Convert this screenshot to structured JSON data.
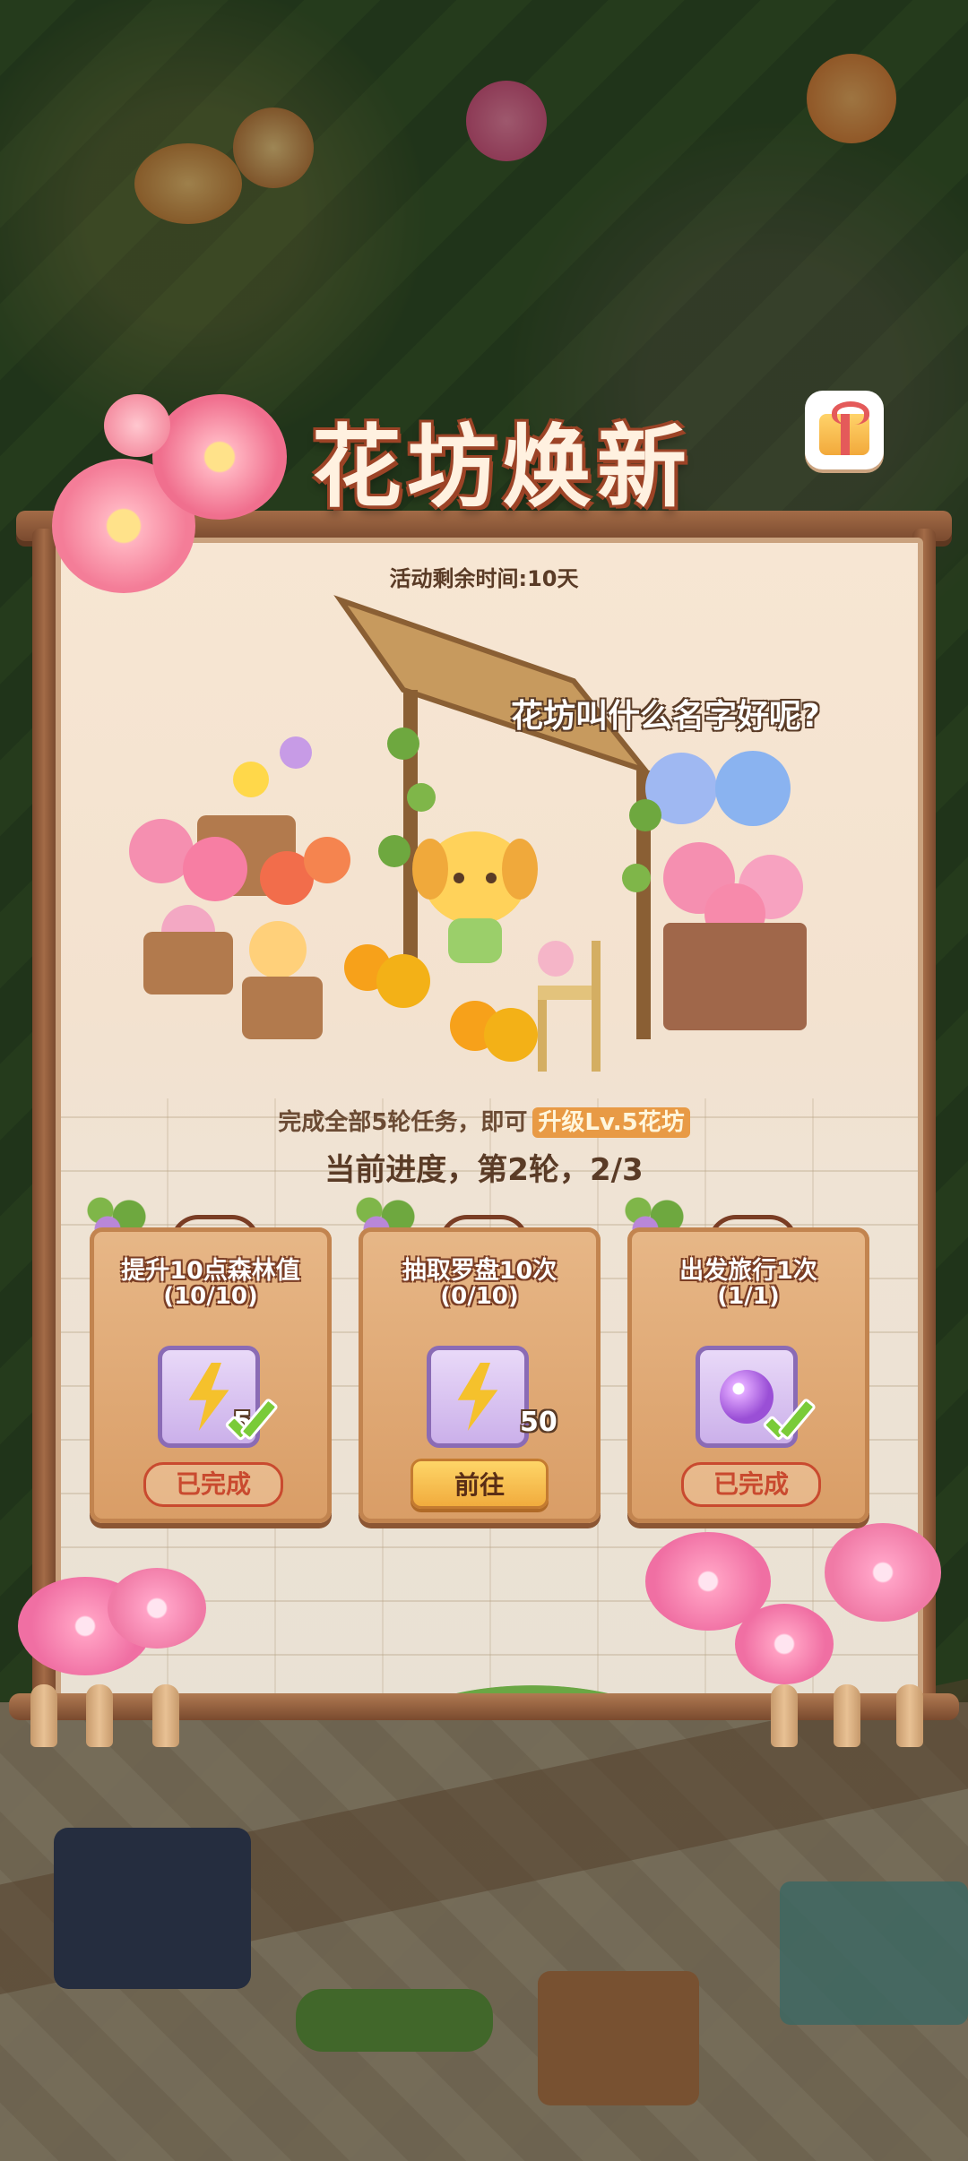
{
  "event": {
    "title": "花坊焕新",
    "timer": "活动剩余时间:10天",
    "speech": "花坊叫什么名字好呢?",
    "task_info_prefix": "完成全部5轮任务，即可",
    "task_info_highlight": "升级Lv.5花坊",
    "progress": "当前进度，第2轮，2/3"
  },
  "tasks": [
    {
      "name": "提升10点森林值",
      "count": "(10/10)",
      "reward_icon": "lightning-icon",
      "reward_qty": "5",
      "state": "已完成"
    },
    {
      "name": "抽取罗盘10次",
      "count": "(0/10)",
      "reward_icon": "lightning-icon",
      "reward_qty": "50",
      "action": "前往"
    },
    {
      "name": "出发旅行1次",
      "count": "(1/1)",
      "reward_icon": "magic-orb-icon",
      "reward_qty": "",
      "state": "已完成"
    }
  ],
  "colors": {
    "title_outline": "#9c4326",
    "highlight": "#e89a45",
    "done_stamp": "#c94a2f",
    "button": "#f0a93b",
    "board": "#f3e2cf"
  },
  "icons": {
    "gift": "gift-icon",
    "check": "check-icon"
  }
}
